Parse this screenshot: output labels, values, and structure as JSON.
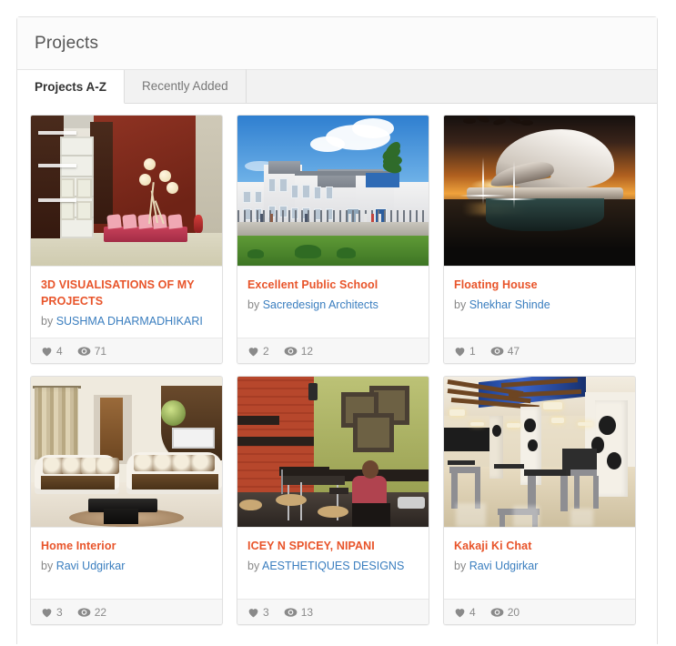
{
  "panel": {
    "title": "Projects"
  },
  "tabs": [
    {
      "label": "Projects A-Z",
      "active": true
    },
    {
      "label": "Recently Added",
      "active": false
    }
  ],
  "colors": {
    "title_link": "#e8542a",
    "author_link": "#3a7ebf",
    "muted_text": "#888888",
    "panel_border": "#e2e2e2",
    "footer_bg": "#f7f7f7"
  },
  "icons": {
    "like": "heart-icon",
    "views": "eye-icon"
  },
  "cards": [
    {
      "title": "3D VISUALISATIONS OF MY PROJECTS",
      "by_label": "by",
      "author": "SUSHMA DHARMADHIKARI",
      "likes": "4",
      "views": "71",
      "thumb_alt": "3d-interior-visualisation-thumbnail"
    },
    {
      "title": "Excellent Public School",
      "by_label": "by",
      "author": "Sacredesign Architects",
      "likes": "2",
      "views": "12",
      "thumb_alt": "school-building-exterior-thumbnail"
    },
    {
      "title": "Floating House",
      "by_label": "by",
      "author": "Shekhar Shinde",
      "likes": "1",
      "views": "47",
      "thumb_alt": "floating-house-sunset-thumbnail"
    },
    {
      "title": "Home Interior",
      "by_label": "by",
      "author": "Ravi Udgirkar",
      "likes": "3",
      "views": "22",
      "thumb_alt": "living-room-interior-thumbnail"
    },
    {
      "title": "ICEY N SPICEY, NIPANI",
      "by_label": "by",
      "author": "AESTHETIQUES DESIGNS",
      "likes": "3",
      "views": "13",
      "thumb_alt": "cafe-brick-wall-thumbnail"
    },
    {
      "title": "Kakaji Ki Chat",
      "by_label": "by",
      "author": "Ravi Udgirkar",
      "likes": "4",
      "views": "20",
      "thumb_alt": "restaurant-hall-thumbnail"
    }
  ]
}
